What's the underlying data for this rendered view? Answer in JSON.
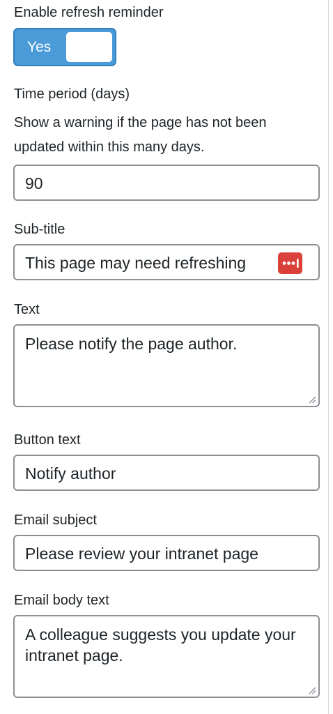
{
  "refresh": {
    "label": "Enable refresh reminder",
    "toggle_label": "Yes",
    "enabled": true
  },
  "time_period": {
    "label": "Time period (days)",
    "description": "Show a warning if the page has not been updated within this many days.",
    "value": "90"
  },
  "subtitle": {
    "label": "Sub-title",
    "value": "This page may need refreshing",
    "extension_icon": "password-manager-icon"
  },
  "text": {
    "label": "Text",
    "value": "Please notify the page author."
  },
  "button_text": {
    "label": "Button text",
    "value": "Notify author"
  },
  "email_subject": {
    "label": "Email subject",
    "value": "Please review your intranet page"
  },
  "email_body": {
    "label": "Email body text",
    "value": "A colleague suggests you update your intranet page."
  },
  "colors": {
    "toggle_on": "#4a9bd8",
    "extension_icon": "#d9413a",
    "field_border": "#8c8f94"
  }
}
